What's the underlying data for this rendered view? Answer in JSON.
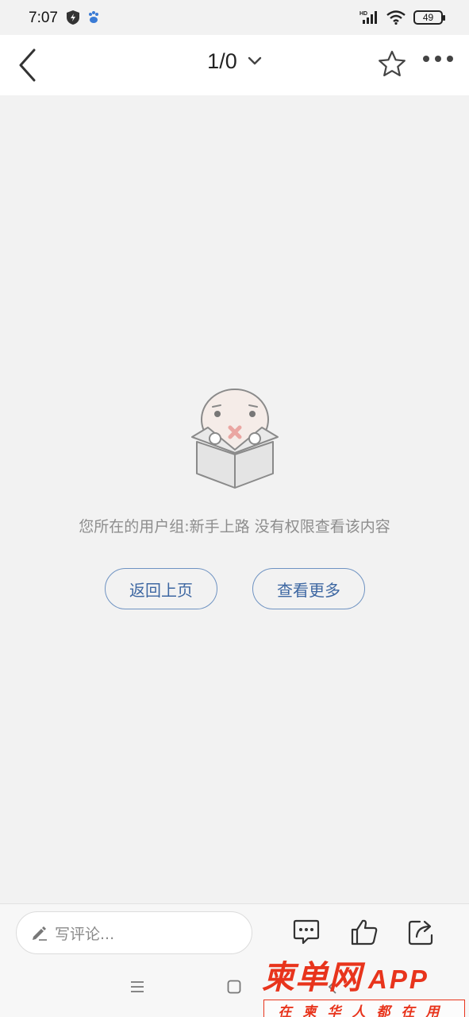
{
  "status_bar": {
    "time": "7:07",
    "hd_label": "HD",
    "battery_level": "49"
  },
  "nav": {
    "page_indicator": "1/0"
  },
  "empty_state": {
    "message": "您所在的用户组:新手上路 没有权限查看该内容",
    "back_button_label": "返回上页",
    "more_button_label": "查看更多"
  },
  "bottom_bar": {
    "comment_placeholder": "写评论..."
  },
  "watermark": {
    "logo_text": "柬单网",
    "app_text": "APP",
    "tagline": "在柬华人都在用"
  },
  "colors": {
    "accent_blue": "#3d67a2",
    "button_border": "#6f93c2",
    "watermark_red": "#e8341c",
    "background": "#f2f2f2"
  },
  "icons": {
    "back": "chevron-left-icon",
    "dropdown": "chevron-down-icon",
    "favorite": "star-icon",
    "more": "more-dots-icon",
    "edit": "pencil-icon",
    "comment": "comment-icon",
    "like": "thumbs-up-icon",
    "share": "share-icon"
  }
}
